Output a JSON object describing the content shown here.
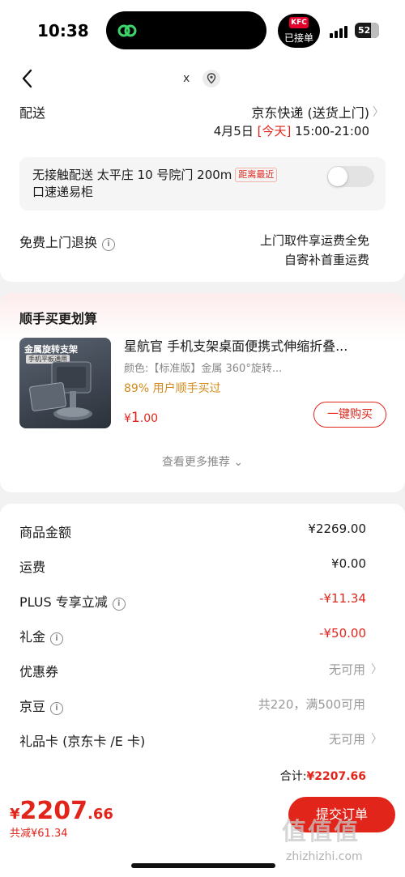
{
  "status_bar": {
    "time": "10:38",
    "kfc_logo": "KFC",
    "kfc_status": "已接单",
    "battery": "52"
  },
  "nav": {
    "x_label": "x"
  },
  "delivery": {
    "label": "配送",
    "method": "京东快递 (送货上门)",
    "date": "4月5日",
    "today": "[今天]",
    "time_range": "15:00-21:00",
    "contactless_line1": "无接触配送  太平庄 10 号院门 200m",
    "contactless_tag": "距离最近",
    "contactless_line2": "口速递易柜",
    "contactless_enabled": false
  },
  "returns": {
    "label": "免费上门退换",
    "line1": "上门取件享运费全免",
    "line2": "自寄补首重运费"
  },
  "recommend": {
    "title": "顺手买更划算",
    "product_img_title": "金属旋转支架",
    "product_img_sub": "手机平板通用",
    "product_name": "星航官 手机支架桌面便携式伸缩折叠...",
    "product_spec": "颜色:【标准版】金属 360°旋转...",
    "bought": "89% 用户顺手买过",
    "price_symbol": "¥",
    "price_int": "1",
    "price_dec": ".00",
    "buy_label": "一键购买",
    "more_label": "查看更多推荐 ⌄"
  },
  "summary": {
    "rows": [
      {
        "label": "商品金额",
        "value": "¥2269.00"
      },
      {
        "label": "运费",
        "value": "¥0.00"
      },
      {
        "label": "PLUS 专享立减",
        "value": "-¥11.34"
      },
      {
        "label": "礼金",
        "value": "-¥50.00"
      },
      {
        "label": "优惠券",
        "value": "无可用"
      },
      {
        "label": "京豆",
        "value": "共220，满500可用"
      },
      {
        "label": "礼品卡 (京东卡 /E 卡)",
        "value": "无可用"
      }
    ],
    "total_label": "合计:",
    "total_value": "¥2207.66"
  },
  "bottom": {
    "price_symbol": "¥",
    "price_int": "2207",
    "price_dec": ".66",
    "saved": "共减¥61.34",
    "submit_label": "提交订单",
    "watermark": "值值值",
    "watermark_sub": "zhizhizhi.com"
  },
  "colors": {
    "accent": "#e1251b",
    "gold": "#d38b1e",
    "muted": "#999999"
  }
}
